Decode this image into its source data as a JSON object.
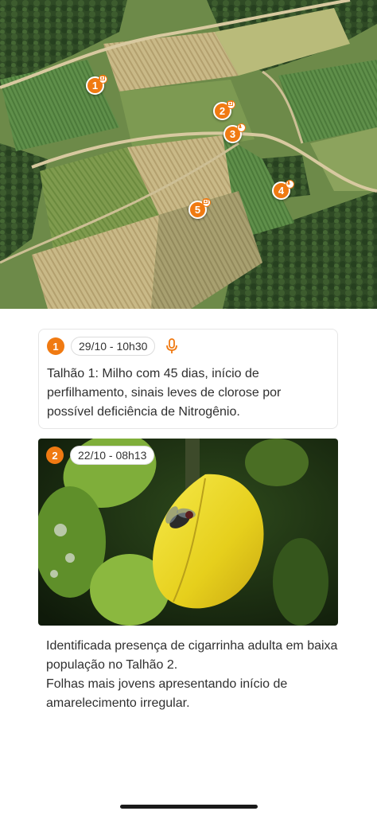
{
  "colors": {
    "accent": "#f07a12",
    "text": "#2f2f2f"
  },
  "map": {
    "pins": [
      {
        "number": "1",
        "icon": "photo-icon"
      },
      {
        "number": "2",
        "icon": "photo-icon"
      },
      {
        "number": "3",
        "icon": "microphone-icon"
      },
      {
        "number": "4",
        "icon": "microphone-icon"
      },
      {
        "number": "5",
        "icon": "photo-icon"
      }
    ]
  },
  "notes": [
    {
      "number": "1",
      "date": "29/10 - 10h30",
      "type_icon": "microphone-icon",
      "text": "Talhão 1: Milho com 45 dias, início de perfilhamento, sinais leves de clorose por possível deficiência de Nitrogênio."
    },
    {
      "number": "2",
      "date": "22/10 - 08h13",
      "photo_subject": "yellowing leaf with leafhopper insect",
      "text": "Identificada presença de cigarrinha adulta em baixa população no Talhão 2.\n Folhas mais jovens apresentando início de amarelecimento irregular."
    }
  ]
}
